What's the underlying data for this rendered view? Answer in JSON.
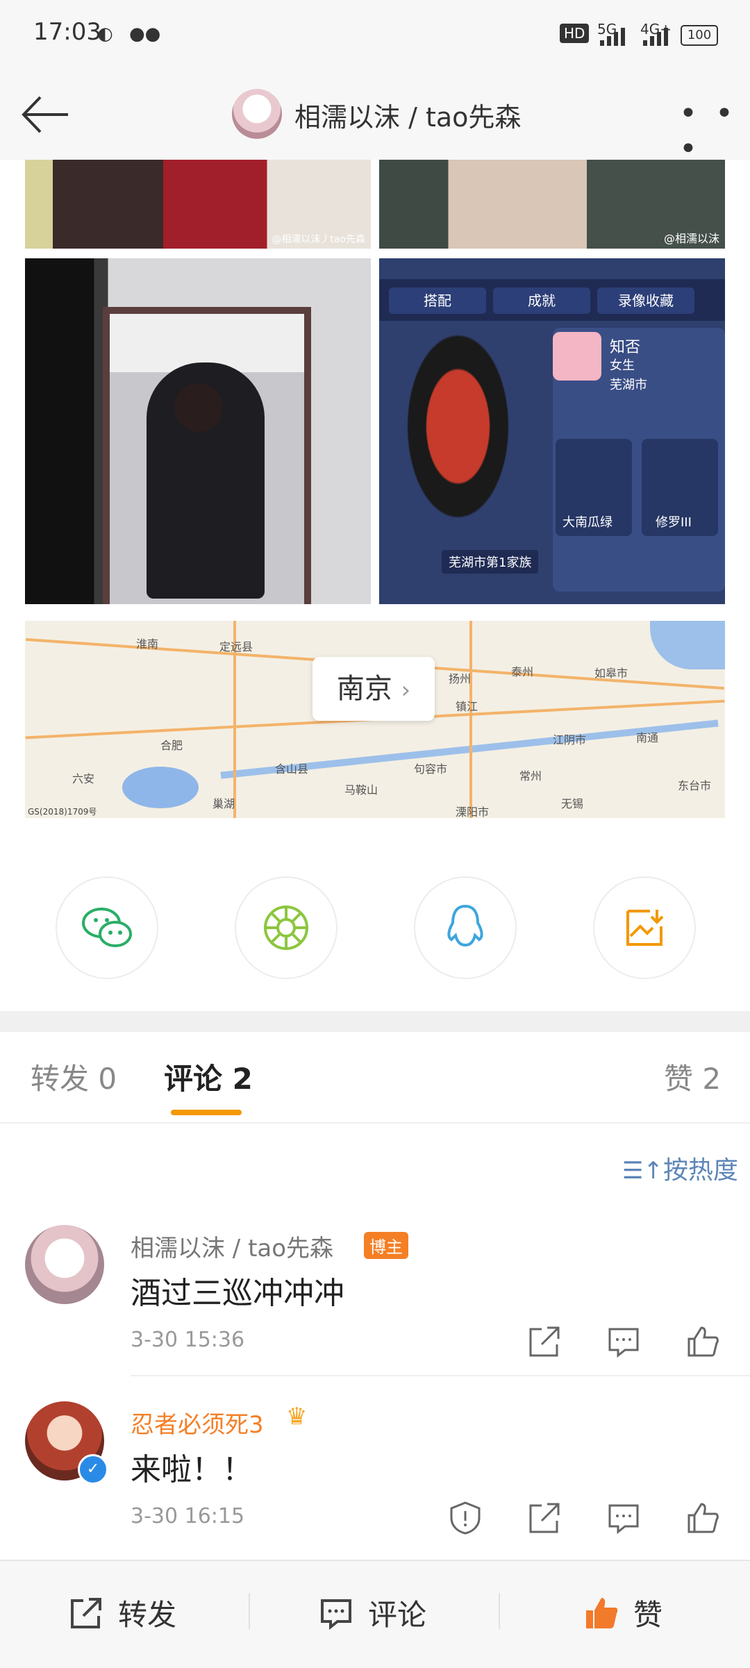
{
  "status_bar": {
    "time": "17:03",
    "icons": [
      "weibo-icon",
      "wechat-icon"
    ],
    "network1": "HD",
    "network2": "5G",
    "network3": "4G+",
    "battery": "100"
  },
  "header": {
    "title": "相濡以沫 / tao先森",
    "more_label": "• • •"
  },
  "photos": {
    "watermark_left": "@相濡以沫丿tao先森",
    "watermark_right": "@相濡以沫",
    "game_tab_1": "搭配",
    "game_tab_2": "成就",
    "game_tab_3": "录像收藏",
    "game_name": "知否",
    "game_gender": "女生",
    "game_city": "芜湖市",
    "game_box_1": "大南瓜绿",
    "game_box_2": "修罗III",
    "game_rank": "芜湖市第1家族"
  },
  "map": {
    "location_label": "南京",
    "places": [
      "淮南",
      "定远县",
      "扬州",
      "泰州",
      "合肥",
      "六安",
      "马鞍山",
      "镇江",
      "常州",
      "南通",
      "无锡",
      "如皋市",
      "东台市",
      "巢湖",
      "含山县",
      "句容市",
      "溧阳市",
      "江阴市"
    ],
    "copyright": "GS(2018)1709号"
  },
  "share": {
    "icons": [
      "wechat-share-icon",
      "moments-share-icon",
      "qq-share-icon",
      "save-image-icon"
    ]
  },
  "tabs": {
    "repost": "转发 0",
    "comment": "评论 2",
    "like": "赞 2",
    "sort": "按热度"
  },
  "comments": [
    {
      "name": "相濡以沫 / tao先森",
      "badge": "博主",
      "text": "酒过三巡冲冲冲",
      "time": "3-30 15:36"
    },
    {
      "name": "忍者必须死3",
      "text": "来啦！！",
      "time": "3-30 16:15"
    }
  ],
  "bottom_bar": {
    "repost": "转发",
    "comment": "评论",
    "like": "赞"
  },
  "colors": {
    "accent": "#f39800",
    "link_blue": "#5d86b8",
    "badge": "#f47f25",
    "like_orange": "#f27a2b"
  }
}
